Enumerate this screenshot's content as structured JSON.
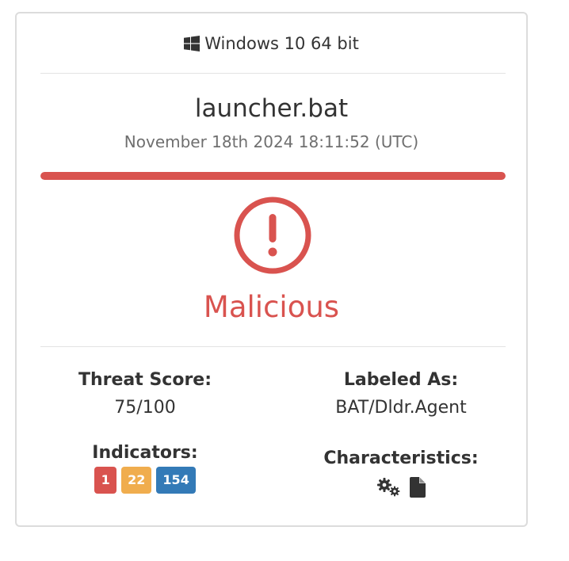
{
  "os": {
    "icon": "windows-icon",
    "label": "Windows 10 64 bit"
  },
  "report": {
    "filename": "launcher.bat",
    "timestamp": "November 18th 2024 18:11:52 (UTC)",
    "threat_level_fill": 1.0,
    "verdict_icon": "exclamation-circle-icon",
    "verdict": "Malicious"
  },
  "threat_score": {
    "label": "Threat Score:",
    "value": "75/100"
  },
  "labeled_as": {
    "label": "Labeled As:",
    "value": "BAT/Dldr.Agent"
  },
  "indicators": {
    "label": "Indicators:",
    "malicious": "1",
    "suspicious": "22",
    "informative": "154"
  },
  "characteristics": {
    "label": "Characteristics:",
    "icons": [
      "gears-icon",
      "file-icon"
    ]
  },
  "colors": {
    "malicious": "#d9534f",
    "suspicious": "#f0ad4e",
    "informative": "#337ab7",
    "text": "#333333",
    "muted": "#6f6f6f"
  }
}
